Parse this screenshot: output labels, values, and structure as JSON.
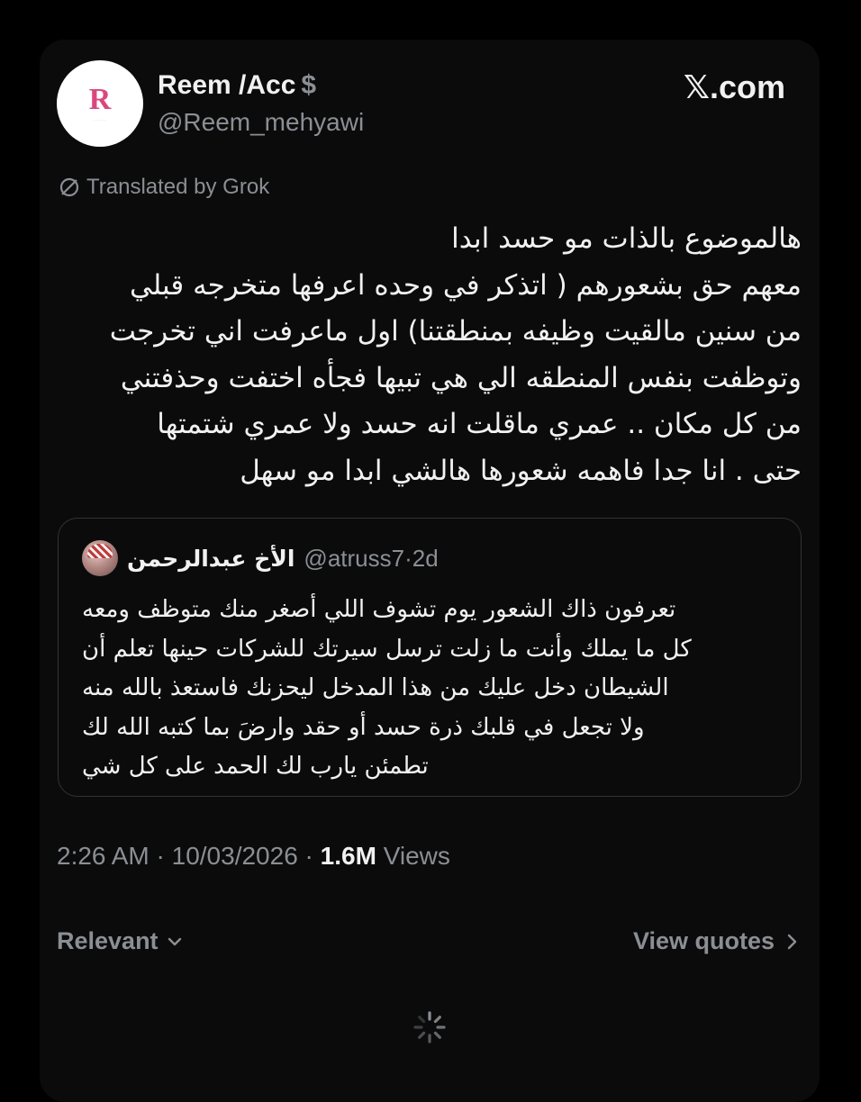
{
  "author": {
    "display_name": "Reem /Acc",
    "handle": "@Reem_mehyawi",
    "avatar_letter": "R",
    "badge_icon": "dollar-icon"
  },
  "brand": "𝕏.com",
  "translation_label": "Translated by Grok",
  "tweet_lines": [
    "هالموضوع بالذات مو حسد ابدا",
    "معهم حق بشعورهم ( اتذكر في وحده اعرفها متخرجه قبلي",
    "من سنين مالقيت وظيفه بمنطقتنا) اول ماعرفت اني تخرجت",
    "وتوظفت بنفس المنطقه الي هي تبيها فجأه اختفت وحذفتني",
    "من كل مكان .. عمري ماقلت انه حسد ولا عمري شتمتها",
    "حتى . انا جدا فاهمه شعورها هالشي ابدا مو سهل"
  ],
  "quoted": {
    "name": "الأخ عبدالرحمن",
    "handle": "@atruss7",
    "separator": "·",
    "age": "2d",
    "lines": [
      "تعرفون ذاك الشعور يوم تشوف اللي أصغر منك متوظف ومعه",
      "كل ما يملك وأنت ما زلت ترسل سيرتك للشركات حينها تعلم أن",
      "الشيطان دخل عليك من هذا المدخل ليحزنك فاستعذ بالله منه",
      "ولا تجعل في قلبك ذرة حسد أو حقد وارضَ بما كتبه الله لك",
      "تطمئن يارب لك الحمد على كل شي"
    ]
  },
  "meta": {
    "time": "2:26 AM",
    "separator": "·",
    "date": "10/03/2026",
    "views_count": "1.6M",
    "views_label": "Views"
  },
  "footer": {
    "sort_label": "Relevant",
    "quotes_label": "View quotes"
  },
  "colors": {
    "background": "#000000",
    "card": "#0b0b0c",
    "text": "#f1f1f1",
    "muted": "#8b8f94",
    "border": "#2f3336",
    "avatar_accent": "#d9487d"
  }
}
